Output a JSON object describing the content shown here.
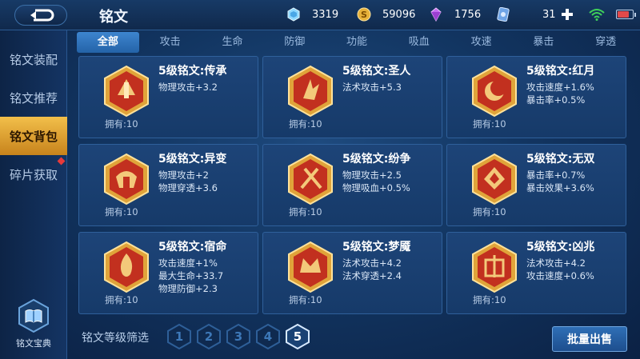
{
  "header": {
    "title": "铭文",
    "currencies": [
      {
        "icon": "diamond-gem-icon",
        "value": "3319"
      },
      {
        "icon": "gold-coin-icon",
        "value": "59096"
      },
      {
        "icon": "purple-crystal-icon",
        "value": "1756"
      },
      {
        "icon": "inscription-ticket-icon",
        "value": "31"
      }
    ]
  },
  "sidebar": {
    "items": [
      {
        "label": "铭文装配"
      },
      {
        "label": "铭文推荐"
      },
      {
        "label": "铭文背包"
      },
      {
        "label": "碎片获取"
      }
    ],
    "codex_label": "铭文宝典"
  },
  "tabs": [
    "全部",
    "攻击",
    "生命",
    "防御",
    "功能",
    "吸血",
    "攻速",
    "暴击",
    "穿透"
  ],
  "cards": [
    {
      "name": "5级铭文:传承",
      "attrs": [
        "物理攻击+3.2"
      ],
      "owned": "拥有:10"
    },
    {
      "name": "5级铭文:圣人",
      "attrs": [
        "法术攻击+5.3"
      ],
      "owned": "拥有:10"
    },
    {
      "name": "5级铭文:红月",
      "attrs": [
        "攻击速度+1.6%",
        "暴击率+0.5%"
      ],
      "owned": "拥有:10"
    },
    {
      "name": "5级铭文:异变",
      "attrs": [
        "物理攻击+2",
        "物理穿透+3.6"
      ],
      "owned": "拥有:10"
    },
    {
      "name": "5级铭文:纷争",
      "attrs": [
        "物理攻击+2.5",
        "物理吸血+0.5%"
      ],
      "owned": "拥有:10"
    },
    {
      "name": "5级铭文:无双",
      "attrs": [
        "暴击率+0.7%",
        "暴击效果+3.6%"
      ],
      "owned": "拥有:10"
    },
    {
      "name": "5级铭文:宿命",
      "attrs": [
        "攻击速度+1%",
        "最大生命+33.7",
        "物理防御+2.3"
      ],
      "owned": "拥有:10"
    },
    {
      "name": "5级铭文:梦魇",
      "attrs": [
        "法术攻击+4.2",
        "法术穿透+2.4"
      ],
      "owned": "拥有:10"
    },
    {
      "name": "5级铭文:凶兆",
      "attrs": [
        "法术攻击+4.2",
        "攻击速度+0.6%"
      ],
      "owned": "拥有:10"
    }
  ],
  "filter": {
    "label": "铭文等级筛选",
    "levels": [
      "1",
      "2",
      "3",
      "4",
      "5"
    ],
    "selected": "5"
  },
  "sell_button": "批量出售",
  "colors": {
    "accent_gold": "#e6a93a",
    "active_tab": "#2e74bf",
    "badge_red": "#c2301f"
  }
}
